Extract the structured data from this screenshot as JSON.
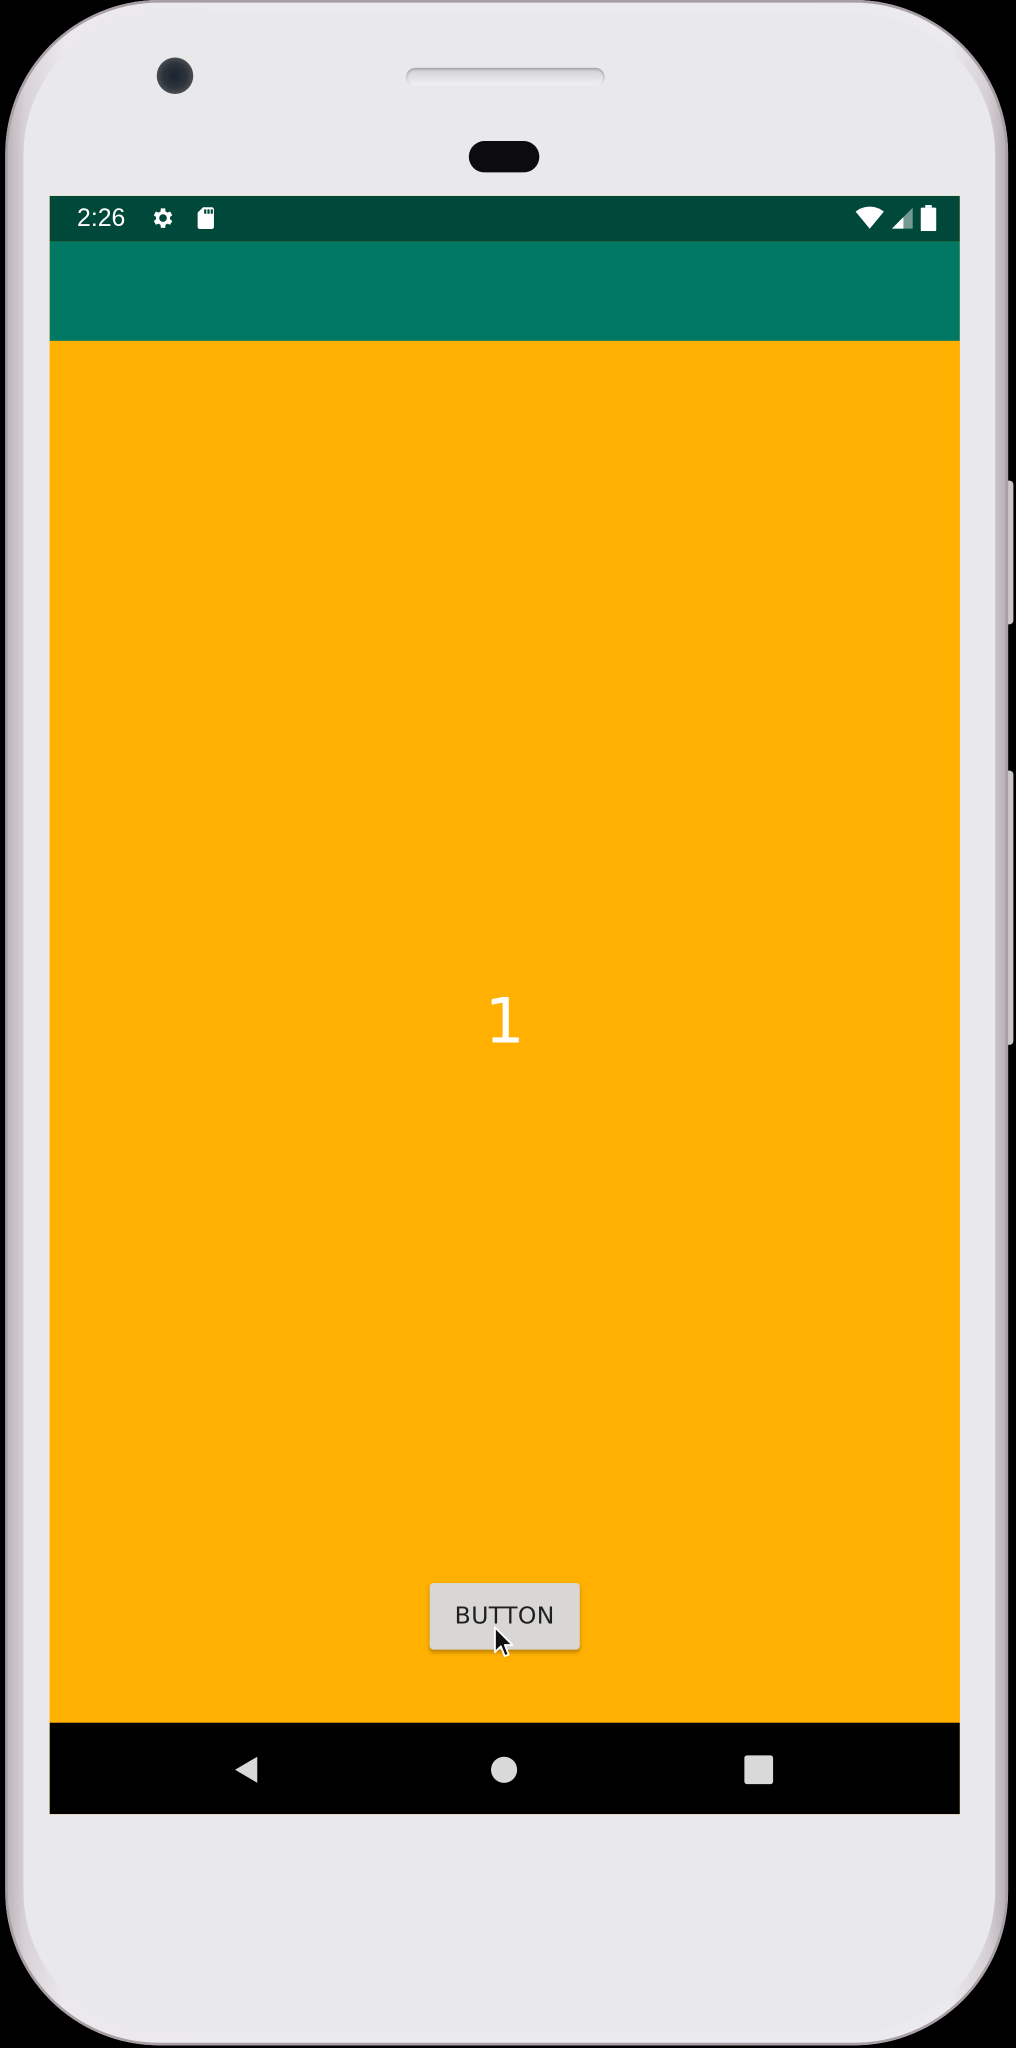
{
  "status_bar": {
    "time": "2:26",
    "left_icons": [
      "gear-icon",
      "sd-card-icon"
    ],
    "right_icons": [
      "wifi-icon",
      "cellular-signal-icon",
      "battery-icon"
    ]
  },
  "toolbar": {
    "color": "#007864"
  },
  "main": {
    "background": "#ffb000",
    "counter_value": "1",
    "button_label": "BUTTON"
  },
  "navigation_bar": {
    "items": [
      "back-button",
      "home-button",
      "recents-button"
    ]
  },
  "colors": {
    "status_bar": "#00483a",
    "toolbar": "#007864",
    "content_background": "#ffb000",
    "navigation_bar": "#000000",
    "button_background": "#d8d7d5",
    "counter_text": "#ffffff"
  }
}
